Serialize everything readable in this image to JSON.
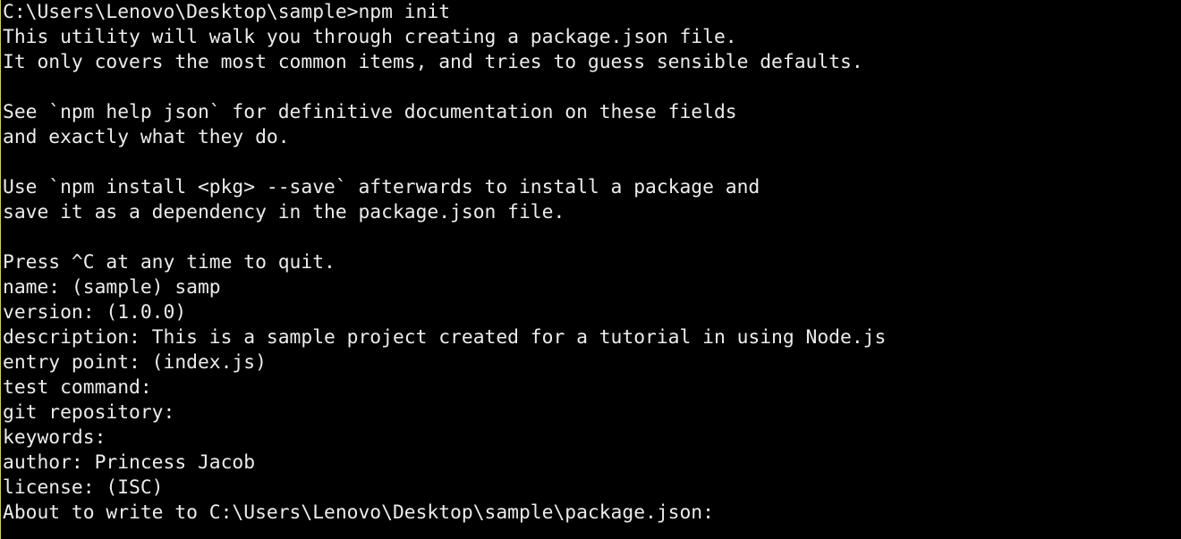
{
  "terminal": {
    "colors": {
      "background": "#000000",
      "foreground": "#ececec",
      "edge": "#d8d800"
    },
    "lines": [
      "C:\\Users\\Lenovo\\Desktop\\sample>npm init",
      "This utility will walk you through creating a package.json file.",
      "It only covers the most common items, and tries to guess sensible defaults.",
      "",
      "See `npm help json` for definitive documentation on these fields",
      "and exactly what they do.",
      "",
      "Use `npm install <pkg> --save` afterwards to install a package and",
      "save it as a dependency in the package.json file.",
      "",
      "Press ^C at any time to quit.",
      "name: (sample) samp",
      "version: (1.0.0)",
      "description: This is a sample project created for a tutorial in using Node.js",
      "entry point: (index.js)",
      "test command:",
      "git repository:",
      "keywords:",
      "author: Princess Jacob",
      "license: (ISC)",
      "About to write to C:\\Users\\Lenovo\\Desktop\\sample\\package.json:"
    ]
  }
}
